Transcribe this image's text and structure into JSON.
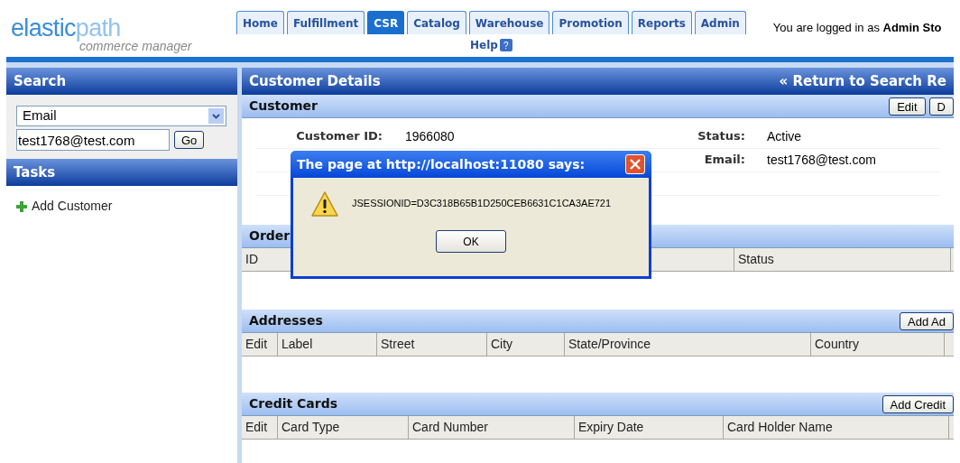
{
  "logo": {
    "brand_1": "elastic",
    "brand_2": "path",
    "tagline": "commerce manager"
  },
  "nav_tabs": [
    {
      "label": "Home",
      "selected": false
    },
    {
      "label": "Fulfillment",
      "selected": false
    },
    {
      "label": "CSR",
      "selected": true
    },
    {
      "label": "Catalog",
      "selected": false
    },
    {
      "label": "Warehouse",
      "selected": false
    },
    {
      "label": "Promotion",
      "selected": false
    },
    {
      "label": "Reports",
      "selected": false
    },
    {
      "label": "Admin",
      "selected": false
    }
  ],
  "help": {
    "label": "Help",
    "icon": "?"
  },
  "login": "You are logged in as **Admin Sto**",
  "search_panel": {
    "title": "Search",
    "select": "Email",
    "input": "test1768@test.com",
    "button": "Go"
  },
  "tasks_panel": {
    "title": "Tasks",
    "items": [
      "Add Customer"
    ]
  },
  "details": {
    "title": "Customer Details",
    "return_link": "« Return to Search Re",
    "customer": {
      "title": "Customer",
      "buttons": [
        "Edit",
        "D"
      ],
      "rows": [
        {
          "left": {
            "label": "Customer ID:",
            "value": "1966080"
          },
          "right": {
            "label": "Status:",
            "value": "Active"
          }
        },
        {
          "right": {
            "label": "Email:",
            "value": "test1768@test.com"
          }
        },
        {},
        {}
      ]
    },
    "orders": {
      "title": "Order",
      "columns": [
        "ID",
        "Status"
      ]
    },
    "addresses": {
      "title": "Addresses",
      "button": "Add Ad",
      "columns": [
        "Edit",
        "Label",
        "Street",
        "City",
        "State/Province",
        "Country"
      ]
    },
    "credit_cards": {
      "title": "Credit Cards",
      "button": "Add Credit",
      "columns": [
        "Edit",
        "Card Type",
        "Card Number",
        "Expiry Date",
        "Card Holder Name"
      ]
    }
  },
  "dialog": {
    "title": "The page at http://localhost:11080 says:",
    "message": "JSESSIONID=D3C318B65B1D250CEB6631C1CA3AE721",
    "button": "OK"
  }
}
